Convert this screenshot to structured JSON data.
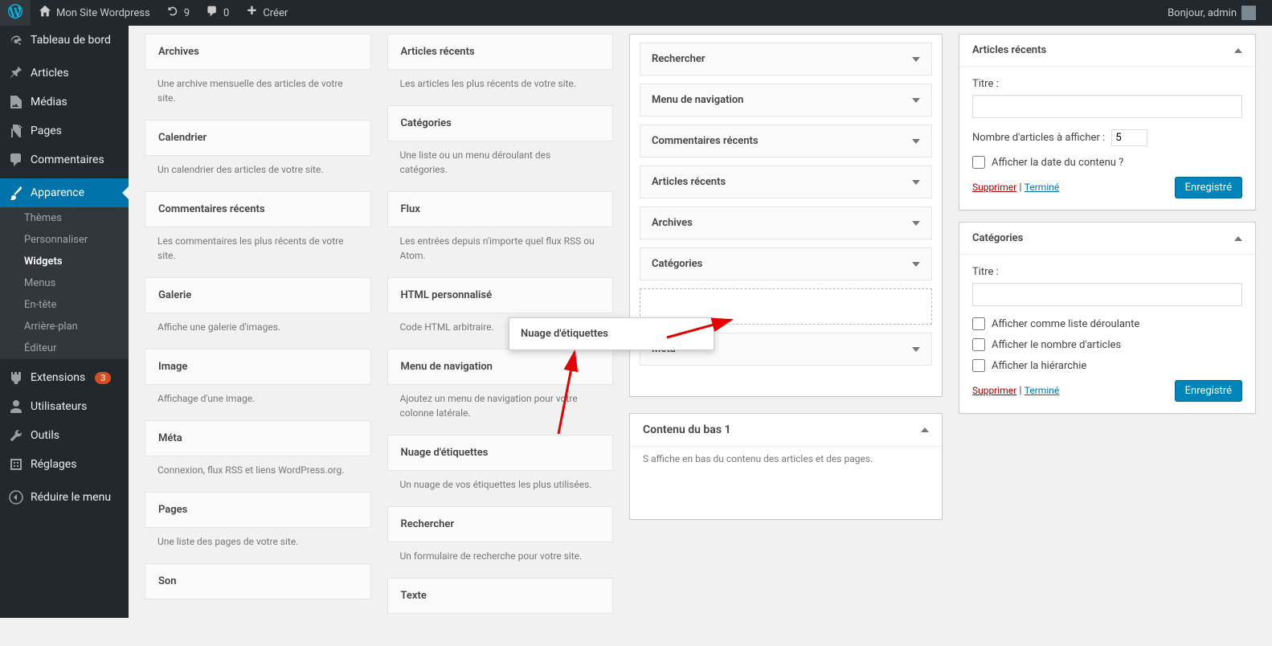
{
  "adminbar": {
    "site_name": "Mon Site Wordpress",
    "updates": "9",
    "comments": "0",
    "create": "Créer",
    "greeting": "Bonjour, admin"
  },
  "sidemenu": {
    "dashboard": "Tableau de bord",
    "posts": "Articles",
    "media": "Médias",
    "pages": "Pages",
    "comments": "Commentaires",
    "appearance": "Apparence",
    "appearance_sub": {
      "themes": "Thèmes",
      "customize": "Personnaliser",
      "widgets": "Widgets",
      "menus": "Menus",
      "header": "En-tête",
      "background": "Arrière-plan",
      "editor": "Éditeur"
    },
    "plugins": "Extensions",
    "plugins_badge": "3",
    "users": "Utilisateurs",
    "tools": "Outils",
    "settings": "Réglages",
    "collapse": "Réduire le menu"
  },
  "available_widgets": {
    "col1": [
      {
        "title": "Archives",
        "desc": "Une archive mensuelle des articles de votre site."
      },
      {
        "title": "Calendrier",
        "desc": "Un calendrier des articles de votre site."
      },
      {
        "title": "Commentaires récents",
        "desc": "Les commentaires les plus récents de votre site."
      },
      {
        "title": "Galerie",
        "desc": "Affiche une galerie d'images."
      },
      {
        "title": "Image",
        "desc": "Affichage d'une image."
      },
      {
        "title": "Méta",
        "desc": "Connexion, flux RSS et liens WordPress.org."
      },
      {
        "title": "Pages",
        "desc": "Une liste des pages de votre site."
      },
      {
        "title": "Son",
        "desc": ""
      }
    ],
    "col2": [
      {
        "title": "Articles récents",
        "desc": "Les articles les plus récents de votre site."
      },
      {
        "title": "Catégories",
        "desc": "Une liste ou un menu déroulant des catégories."
      },
      {
        "title": "Flux",
        "desc": "Les entrées depuis n'importe quel flux RSS ou Atom."
      },
      {
        "title": "HTML personnalisé",
        "desc": "Code HTML arbitraire."
      },
      {
        "title": "Menu de navigation",
        "desc": "Ajoutez un menu de navigation pour votre colonne latérale."
      },
      {
        "title": "Nuage d'étiquettes",
        "desc": "Un nuage de vos étiquettes les plus utilisées."
      },
      {
        "title": "Rechercher",
        "desc": "Un formulaire de recherche pour votre site."
      },
      {
        "title": "Texte",
        "desc": ""
      }
    ]
  },
  "drag_ghost": "Nuage d'étiquettes",
  "sidebar_area": {
    "placed": [
      "Rechercher",
      "Menu de navigation",
      "Commentaires récents",
      "Articles récents",
      "Archives",
      "Catégories"
    ],
    "meta": "Méta"
  },
  "bottom_area": {
    "title": "Contenu du bas 1",
    "desc": "S affiche en bas du contenu des articles et des pages."
  },
  "config_recent": {
    "title": "Articles récents",
    "label_title": "Titre :",
    "label_count": "Nombre d'articles à afficher :",
    "count_value": "5",
    "show_date": "Afficher la date du contenu ?",
    "delete": "Supprimer",
    "done": "Terminé",
    "save": "Enregistré"
  },
  "config_cats": {
    "title": "Catégories",
    "label_title": "Titre :",
    "dropdown": "Afficher comme liste déroulante",
    "count": "Afficher le nombre d'articles",
    "hierarchy": "Afficher la hiérarchie",
    "delete": "Supprimer",
    "done": "Terminé",
    "save": "Enregistré"
  },
  "sep": " | "
}
